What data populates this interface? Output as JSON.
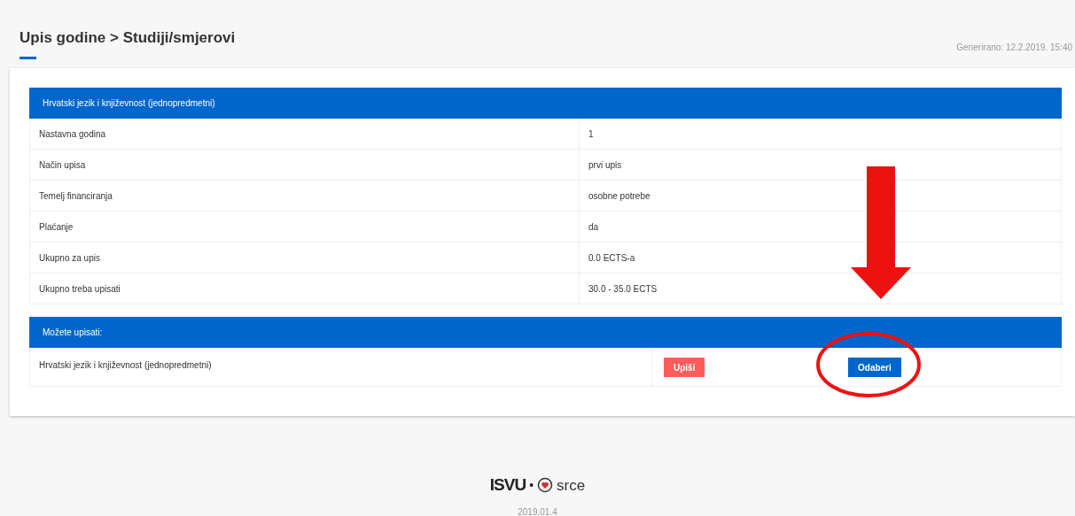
{
  "page": {
    "breadcrumb": "Upis godine > Studiji/smjerovi",
    "generated": "Generirano: 12.2.2019. 15:40"
  },
  "details": {
    "title": "Hrvatski jezik i književnost (jednopredmetni)",
    "rows": [
      {
        "label": "Nastavna godina",
        "value": "1"
      },
      {
        "label": "Način upisa",
        "value": "prvi upis"
      },
      {
        "label": "Temelj financiranja",
        "value": "osobne potrebe"
      },
      {
        "label": "Plaćanje",
        "value": "da"
      },
      {
        "label": "Ukupno za upis",
        "value": "0.0 ECTS-a"
      },
      {
        "label": "Ukupno treba upisati",
        "value": "30.0 - 35.0 ECTS"
      }
    ]
  },
  "options": {
    "title": "Možete upisati:",
    "rows": [
      {
        "name": "Hrvatski jezik i književnost (jednopredmetni)",
        "enroll_button": "Upiši",
        "select_button": "Odaberi"
      }
    ]
  },
  "footer": {
    "logo_left": "ISVU",
    "separator": "•",
    "logo_right": "srce",
    "version": "2019.01.4"
  }
}
